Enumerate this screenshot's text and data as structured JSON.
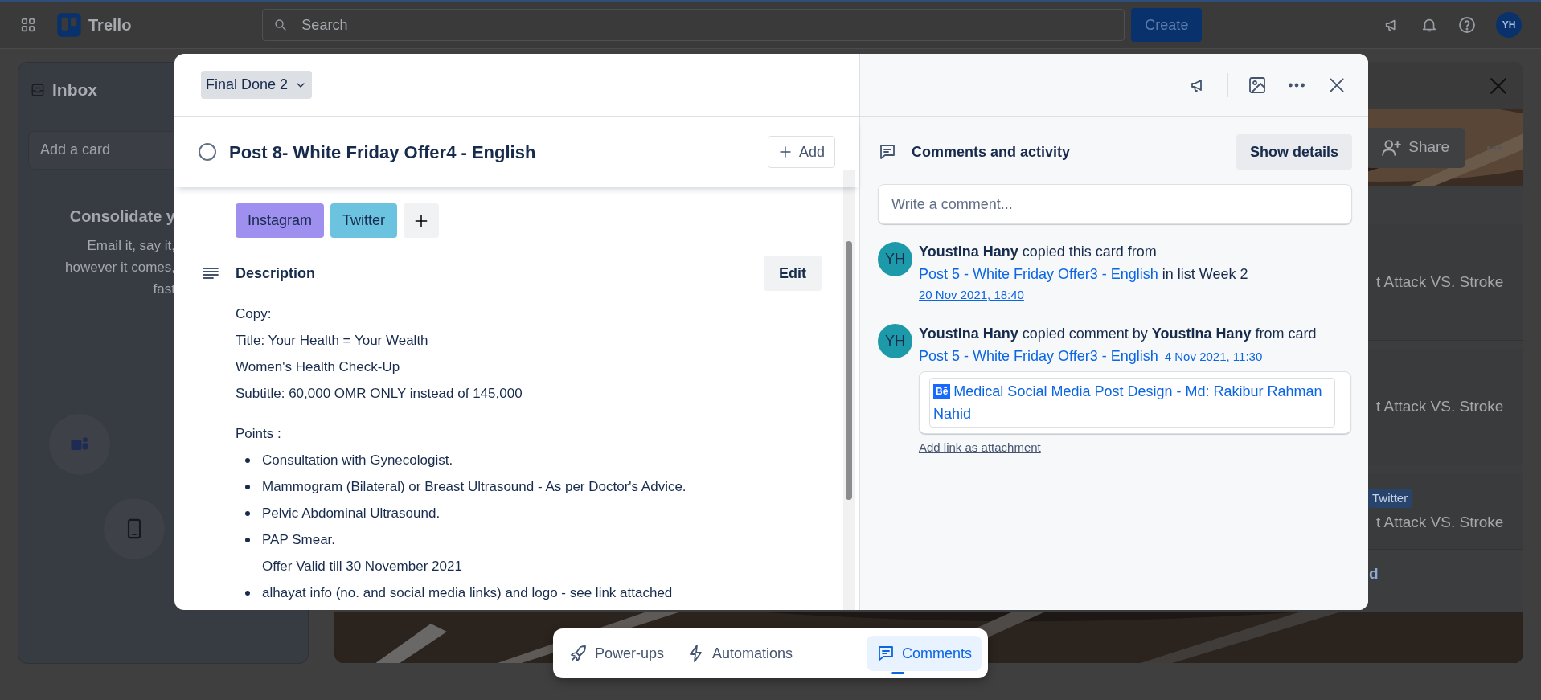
{
  "topbar": {
    "app_name": "Trello",
    "search": {
      "placeholder": "Search"
    },
    "create_label": "Create",
    "avatar": "YH"
  },
  "inbox": {
    "title": "Inbox",
    "add_card": {
      "placeholder": "Add a card"
    },
    "heading": "Consolidate y",
    "body_lines": [
      "Email it, say it,",
      "however it comes,",
      "fast"
    ]
  },
  "board": {
    "share_label": "Share",
    "cards": [
      {
        "text": "t Attack VS. Stroke"
      },
      {
        "text": "t Attack VS. Stroke"
      },
      {
        "label": "Twitter",
        "text": "t Attack VS. Stroke"
      }
    ],
    "add_card_fragment": "d"
  },
  "card_modal": {
    "list_name": "Final Done 2",
    "title": "Post 8- White Friday Offer4 - English",
    "completed": false,
    "add_label": "Add",
    "labels": [
      {
        "text": "Instagram",
        "color": "#9f8fef"
      },
      {
        "text": "Twitter",
        "color": "#6cc3e0"
      }
    ],
    "description": {
      "heading": "Description",
      "edit_label": "Edit",
      "copy_lines": [
        "Copy:",
        "Title: Your Health = Your Wealth",
        "Women's Health Check-Up",
        "Subtitle: 60,000 OMR ONLY instead of 145,000"
      ],
      "points_heading": "Points :",
      "points": [
        {
          "kind": "bullet",
          "text": "Consultation with Gynecologist."
        },
        {
          "kind": "bullet",
          "text": "Mammogram (Bilateral) or Breast Ultrasound - As per Doctor's Advice."
        },
        {
          "kind": "bullet",
          "text": "Pelvic Abdominal Ultrasound."
        },
        {
          "kind": "bullet",
          "text": "PAP Smear."
        },
        {
          "kind": "continuation",
          "text": "Offer Valid till 30 November 2021"
        },
        {
          "kind": "bullet",
          "text": "alhayat info (no. and social media links) and logo - see link attached"
        }
      ]
    }
  },
  "activity": {
    "heading": "Comments and activity",
    "toggle_label": "Show details",
    "comment": {
      "placeholder": "Write a comment..."
    },
    "items": [
      {
        "kind": "copy_card",
        "avatar": "YH",
        "parts": [
          {
            "kind": "name",
            "text": "Youstina Hany"
          },
          {
            "kind": "text",
            "text": " copied this card from "
          },
          {
            "kind": "link",
            "text": "Post 5 - White Friday Offer3 - English"
          },
          {
            "kind": "text",
            "text": " in list Week 2"
          }
        ],
        "time": "20 Nov 2021, 18:40"
      },
      {
        "kind": "copy_comment",
        "avatar": "YH",
        "parts": [
          {
            "kind": "name",
            "text": "Youstina Hany"
          },
          {
            "kind": "text",
            "text": " copied comment by "
          },
          {
            "kind": "name",
            "text": "Youstina Hany"
          },
          {
            "kind": "text",
            "text": " from card "
          },
          {
            "kind": "link",
            "text": "Post 5 - White Friday Offer3 - English"
          }
        ],
        "time": "4 Nov 2021, 11:30",
        "attachment": {
          "badge": "Bē",
          "title": "Medical Social Media Post Design - Md: Rakibur Rahman Nahid"
        }
      }
    ],
    "add_attachment_label": "Add link as attachment"
  },
  "dock": {
    "tabs": [
      {
        "label": "Power-ups",
        "selected": false
      },
      {
        "label": "Automations",
        "selected": false
      },
      {
        "label": "Comments",
        "selected": true
      }
    ]
  }
}
